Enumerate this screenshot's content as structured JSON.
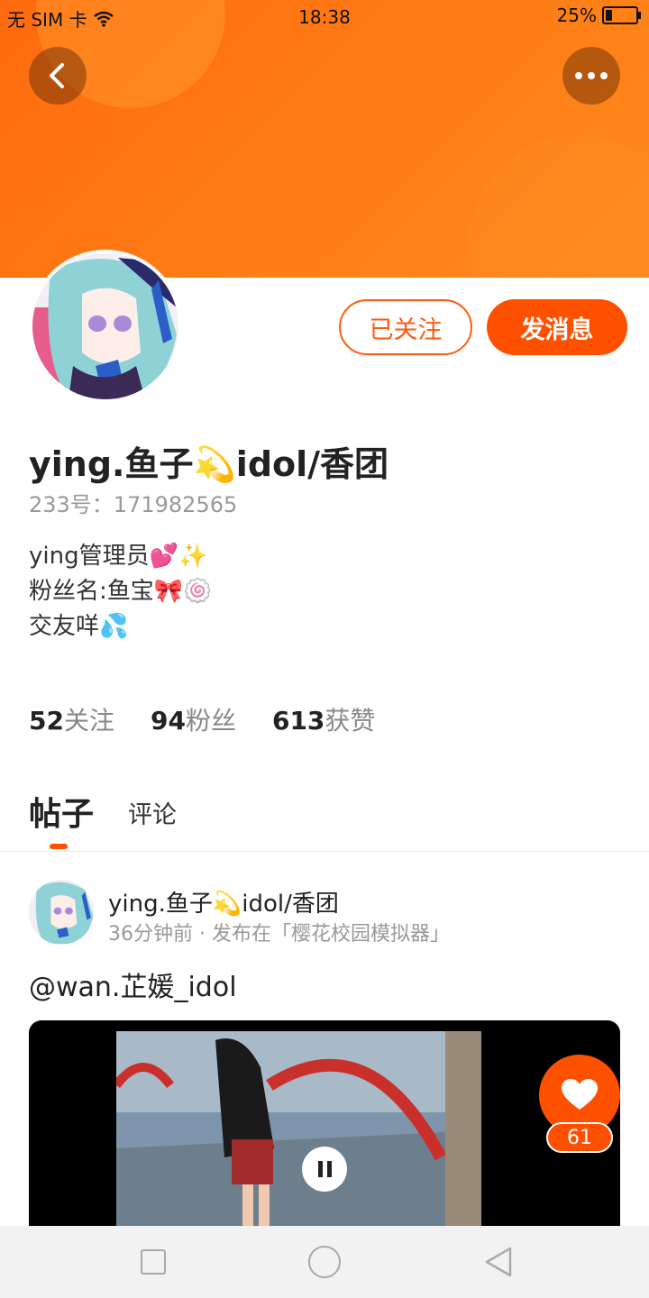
{
  "status_bar": {
    "carrier": "无 SIM 卡",
    "time": "18:38",
    "battery": "25%",
    "battery_level": 0.25
  },
  "profile": {
    "follow_label": "已关注",
    "message_label": "发消息",
    "name": "ying.鱼子💫idol/香团",
    "uid": "233号：171982565",
    "bio": [
      "ying管理员💕✨",
      "粉丝名:鱼宝🎀🍥",
      "交友咩💦"
    ],
    "stats": [
      {
        "count": "52",
        "label": "关注"
      },
      {
        "count": "94",
        "label": "粉丝"
      },
      {
        "count": "613",
        "label": "获赞"
      }
    ]
  },
  "tabs": [
    {
      "label": "帖子",
      "active": true
    },
    {
      "label": "评论",
      "active": false
    }
  ],
  "post": {
    "author": "ying.鱼子💫idol/香团",
    "meta": "36分钟前 · 发布在「樱花校园模拟器」",
    "text": "@wan.芷媛_idol",
    "like_count": "61"
  },
  "colors": {
    "accent": "#ff5000",
    "banner": "#ff7a14"
  },
  "icons": [
    "back-arrow-icon",
    "more-dots-icon",
    "wifi-icon",
    "battery-icon",
    "pause-icon",
    "heart-icon"
  ]
}
